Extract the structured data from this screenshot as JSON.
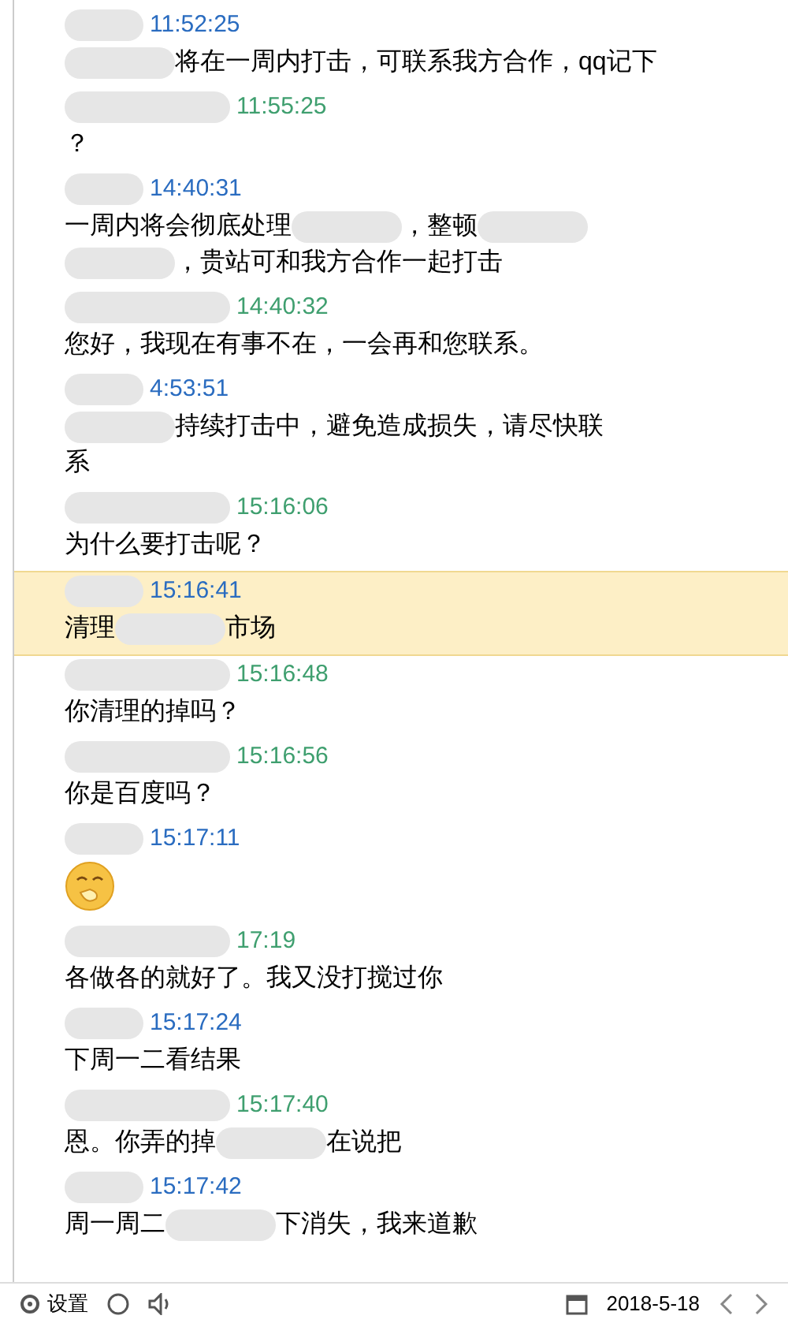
{
  "messages": [
    {
      "kind": "other",
      "time": "11:52:25",
      "selected": false,
      "segments": [
        {
          "kind": "blur"
        },
        {
          "kind": "text",
          "text": "将在一周内打击，可联系我方合作，qq记下"
        }
      ]
    },
    {
      "kind": "self",
      "time": "11:55:25",
      "selected": false,
      "segments": [
        {
          "kind": "text",
          "text": "？"
        }
      ]
    },
    {
      "kind": "other",
      "time": "14:40:31",
      "selected": false,
      "segments": [
        {
          "kind": "text",
          "text": "一周内将会彻底处理"
        },
        {
          "kind": "blur"
        },
        {
          "kind": "text",
          "text": "，整顿"
        },
        {
          "kind": "blur"
        },
        {
          "kind": "break"
        },
        {
          "kind": "blur"
        },
        {
          "kind": "text",
          "text": "，贵站可和我方合作一起打击"
        }
      ]
    },
    {
      "kind": "self",
      "time": "14:40:32",
      "selected": false,
      "segments": [
        {
          "kind": "text",
          "text": "您好，我现在有事不在，一会再和您联系。"
        }
      ]
    },
    {
      "kind": "other",
      "time": "4:53:51",
      "selected": false,
      "segments": [
        {
          "kind": "blur"
        },
        {
          "kind": "text",
          "text": "持续打击中，避免造成损失，请尽快联"
        },
        {
          "kind": "break"
        },
        {
          "kind": "text",
          "text": "系"
        }
      ]
    },
    {
      "kind": "self",
      "time": "15:16:06",
      "selected": false,
      "segments": [
        {
          "kind": "text",
          "text": "为什么要打击呢？"
        }
      ]
    },
    {
      "kind": "other",
      "time": "15:16:41",
      "selected": true,
      "segments": [
        {
          "kind": "text",
          "text": "清理"
        },
        {
          "kind": "blur"
        },
        {
          "kind": "text",
          "text": "市场"
        }
      ]
    },
    {
      "kind": "self",
      "time": "15:16:48",
      "selected": false,
      "segments": [
        {
          "kind": "text",
          "text": "你清理的掉吗？"
        }
      ]
    },
    {
      "kind": "self",
      "time": "15:16:56",
      "selected": false,
      "segments": [
        {
          "kind": "text",
          "text": "你是百度吗？"
        }
      ]
    },
    {
      "kind": "other",
      "time": "15:17:11",
      "selected": false,
      "segments": [
        {
          "kind": "emoji"
        }
      ]
    },
    {
      "kind": "self",
      "time": "17:19",
      "selected": false,
      "segments": [
        {
          "kind": "text",
          "text": "各做各的就好了。我又没打搅过你"
        }
      ]
    },
    {
      "kind": "other",
      "time": "15:17:24",
      "selected": false,
      "segments": [
        {
          "kind": "text",
          "text": "下周一二看结果"
        }
      ]
    },
    {
      "kind": "self",
      "time": "15:17:40",
      "selected": false,
      "segments": [
        {
          "kind": "text",
          "text": "恩。你弄的掉"
        },
        {
          "kind": "blur"
        },
        {
          "kind": "text",
          "text": "在说把"
        }
      ]
    },
    {
      "kind": "other",
      "time": "15:17:42",
      "selected": false,
      "segments": [
        {
          "kind": "text",
          "text": "周一周二"
        },
        {
          "kind": "blur"
        },
        {
          "kind": "text",
          "text": "下消失，我来道歉"
        }
      ]
    }
  ],
  "toolbar": {
    "settings_label": "设置",
    "date": "2018-5-18"
  }
}
